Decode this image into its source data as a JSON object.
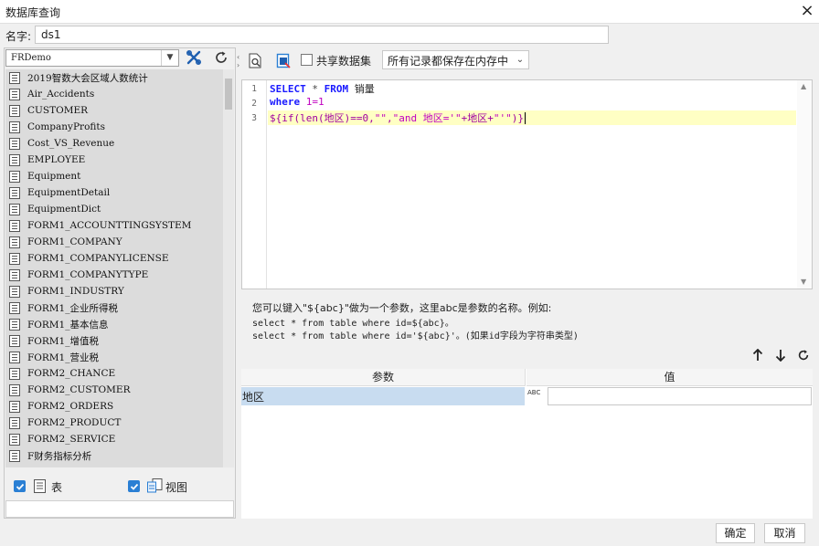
{
  "window": {
    "title": "数据库查询"
  },
  "name": {
    "label": "名字:",
    "value": "ds1"
  },
  "datasource": {
    "selected": "FRDemo"
  },
  "toolbar": {
    "share_label": "共享数据集",
    "memory_option": "所有记录都保存在内存中"
  },
  "tables": [
    "2019智数大会区域人数统计",
    "Air_Accidents",
    "CUSTOMER",
    "CompanyProfits",
    "Cost_VS_Revenue",
    "EMPLOYEE",
    "Equipment",
    "EquipmentDetail",
    "EquipmentDict",
    "FORM1_ACCOUNTTINGSYSTEM",
    "FORM1_COMPANY",
    "FORM1_COMPANYLICENSE",
    "FORM1_COMPANYTYPE",
    "FORM1_INDUSTRY",
    "FORM1_企业所得税",
    "FORM1_基本信息",
    "FORM1_增值税",
    "FORM1_营业税",
    "FORM2_CHANCE",
    "FORM2_CUSTOMER",
    "FORM2_ORDERS",
    "FORM2_PRODUCT",
    "FORM2_SERVICE",
    "F财务指标分析"
  ],
  "filters": {
    "table_label": "表",
    "view_label": "视图"
  },
  "editor": {
    "line_numbers": [
      "1",
      "2",
      "3"
    ],
    "line1": {
      "kw1": "SELECT",
      "star": " * ",
      "kw2": "FROM",
      "rest": " 销量"
    },
    "line2": {
      "kw": "where",
      "rest": " 1=1"
    },
    "line3": {
      "a": "${if(len(地区)==0,",
      "b": "\"\"",
      "c": ",",
      "d": "\"and 地区='\"",
      "e": "+地区+",
      "f": "\"'\"",
      "g": ")}"
    }
  },
  "hint": {
    "line1": "您可以键入\"${abc}\"做为一个参数，这里abc是参数的名称。例如:",
    "line2": "select * from table where id=${abc}。",
    "line3": "select * from table where id='${abc}'。(如果id字段为字符串类型)"
  },
  "params": {
    "header_param": "参数",
    "header_value": "值",
    "rows": [
      {
        "name": "地区",
        "type_icon": "ABC",
        "value": ""
      }
    ]
  },
  "footer": {
    "ok_label": "确定",
    "cancel_label": "取消"
  }
}
